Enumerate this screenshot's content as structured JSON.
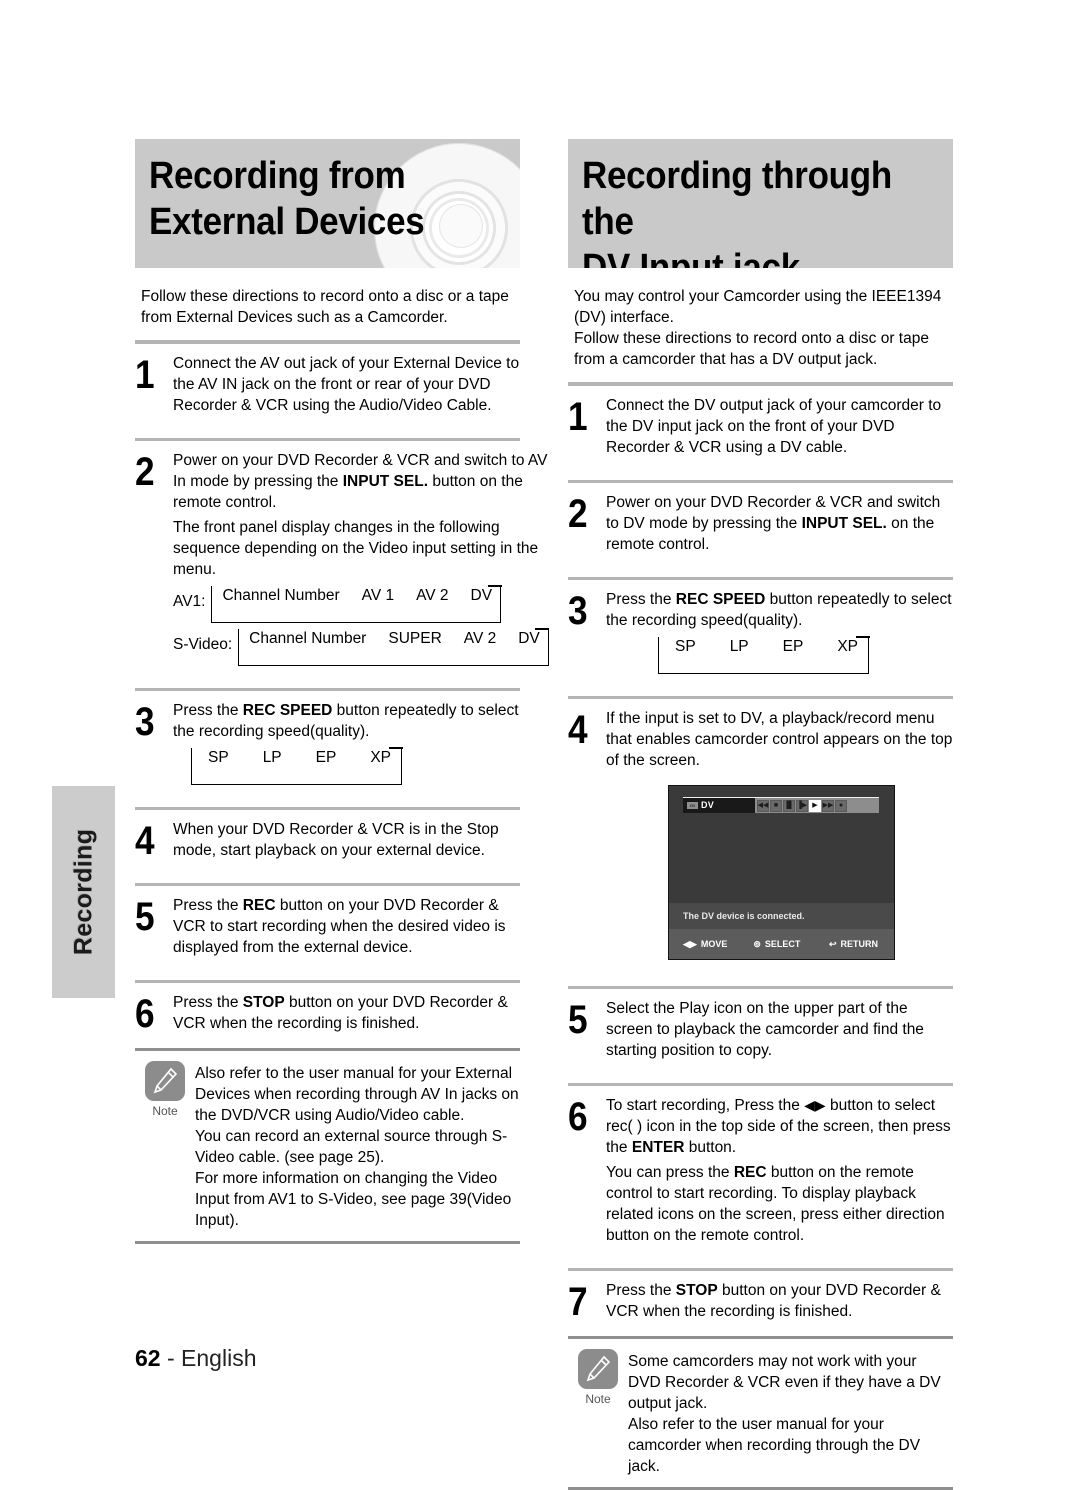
{
  "side_tab": {
    "label": "Recording"
  },
  "left": {
    "header": {
      "line1": "Recording from",
      "line2": "External Devices",
      "graphic": "dvd-disc-icon"
    },
    "intro": "Follow these directions to record onto a disc or a tape from External Devices such as a Camcorder.",
    "steps": [
      {
        "num": "1",
        "text": "Connect the AV out jack of your External Device to the AV IN jack on the front or rear of your DVD Recorder & VCR using the Audio/Video Cable."
      },
      {
        "num": "2",
        "text_a": "Power on your DVD Recorder & VCR and switch to AV In mode by pressing the ",
        "bold_a": "INPUT SEL.",
        "text_b": " button on the remote control.",
        "text_c": "The front panel display changes in the following sequence depending on the Video input setting in the menu."
      },
      {
        "num": "3",
        "text_a": "Press the ",
        "bold_a": "REC SPEED",
        "text_b": " button repeatedly to select the recording speed(quality)."
      },
      {
        "num": "4",
        "text": "When your DVD Recorder & VCR is in the Stop mode, start playback on your external device."
      },
      {
        "num": "5",
        "text_a": "Press the ",
        "bold_a": "REC",
        "text_b": " button on your DVD Recorder & VCR to start recording when the desired video is displayed from the external device."
      },
      {
        "num": "6",
        "text_a": "Press the ",
        "bold_a": "STOP",
        "text_b": " button on your DVD Recorder & VCR when the recording is finished."
      }
    ],
    "cycles": [
      {
        "lead": "AV1:",
        "items": [
          "Channel Number",
          "AV 1",
          "AV 2",
          "DV"
        ]
      },
      {
        "lead": "S-Video:",
        "items": [
          "Channel Number",
          "SUPER",
          "AV 2",
          "DV"
        ]
      }
    ],
    "speed_cycle": {
      "items": [
        "SP",
        "LP",
        "EP",
        "XP"
      ]
    },
    "note": {
      "icon_label": "Note",
      "lines": [
        "Also refer to the user manual for your External Devices when recording through AV In jacks on the DVD/VCR using Audio/Video cable.",
        "You can record an external source through S-Video cable. (see page 25).",
        "For more information on changing the Video Input from AV1 to S-Video, see page 39(Video Input)."
      ]
    }
  },
  "right": {
    "header": {
      "line1": "Recording through the",
      "line2": "DV Input jack"
    },
    "intro_1": "You may control your Camcorder using the IEEE1394 (DV) interface.",
    "intro_2": "Follow these directions to record onto a disc or tape from a camcorder that has a DV output jack.",
    "steps": [
      {
        "num": "1",
        "text": "Connect the DV output jack of your camcorder to the DV input jack on the front of your DVD Recorder & VCR using a DV cable."
      },
      {
        "num": "2",
        "text_a": "Power on your DVD Recorder & VCR and switch to DV mode by pressing the ",
        "bold_a": "INPUT SEL.",
        "text_b": " on the remote control."
      },
      {
        "num": "3",
        "text_a": "Press the ",
        "bold_a": "REC SPEED",
        "text_b": " button repeatedly to select the recording speed(quality)."
      },
      {
        "num": "4",
        "text": "If the input is set to DV, a playback/record menu that enables camcorder control appears on the top of the screen."
      },
      {
        "num": "5",
        "text": "Select the Play icon on the upper part of the screen to playback the camcorder and find the starting position to copy."
      },
      {
        "num": "6",
        "text_a": "To start recording, Press the ",
        "glyph_a": "◀▶",
        "text_b": " button to select rec(  ) icon in the top side of the screen, then press the ",
        "bold_a": "ENTER",
        "text_c": " button.",
        "text_d": "You can press the ",
        "bold_b": "REC",
        "text_e": " button on the remote control to start recording. To display playback related icons on the screen, press either direction button on the remote control."
      },
      {
        "num": "7",
        "text_a": "Press the ",
        "bold_a": "STOP",
        "text_b": " button on your DVD Recorder & VCR when the recording is finished."
      }
    ],
    "speed_cycle": {
      "items": [
        "SP",
        "LP",
        "EP",
        "XP"
      ]
    },
    "dv_screen": {
      "tag_icon": "dv-logo-icon",
      "tag_label": "DV",
      "buttons": [
        {
          "name": "rewind-button",
          "glyph": "◀◀",
          "selected": false
        },
        {
          "name": "stop-button",
          "glyph": "■",
          "selected": false
        },
        {
          "name": "pause-button",
          "glyph": "▐▌",
          "selected": false
        },
        {
          "name": "step-button",
          "glyph": "▐▶",
          "selected": false
        },
        {
          "name": "play-button",
          "glyph": "▶",
          "selected": true
        },
        {
          "name": "fast-forward-button",
          "glyph": "▶▶",
          "selected": false
        },
        {
          "name": "record-button",
          "glyph": "●",
          "selected": false
        }
      ],
      "message": "The DV device is connected.",
      "footer": [
        {
          "glyph": "◀▶",
          "label": "MOVE"
        },
        {
          "glyph": "⊚",
          "label": "SELECT"
        },
        {
          "glyph": "↩",
          "label": "RETURN"
        }
      ]
    },
    "note": {
      "icon_label": "Note",
      "lines": [
        "Some camcorders may not work with your DVD Recorder & VCR even if they have a DV output jack.",
        "Also refer to the user manual for your camcorder when recording through the DV jack."
      ]
    }
  },
  "footer": {
    "page_number": "62",
    "dash": "-",
    "language": "English"
  }
}
